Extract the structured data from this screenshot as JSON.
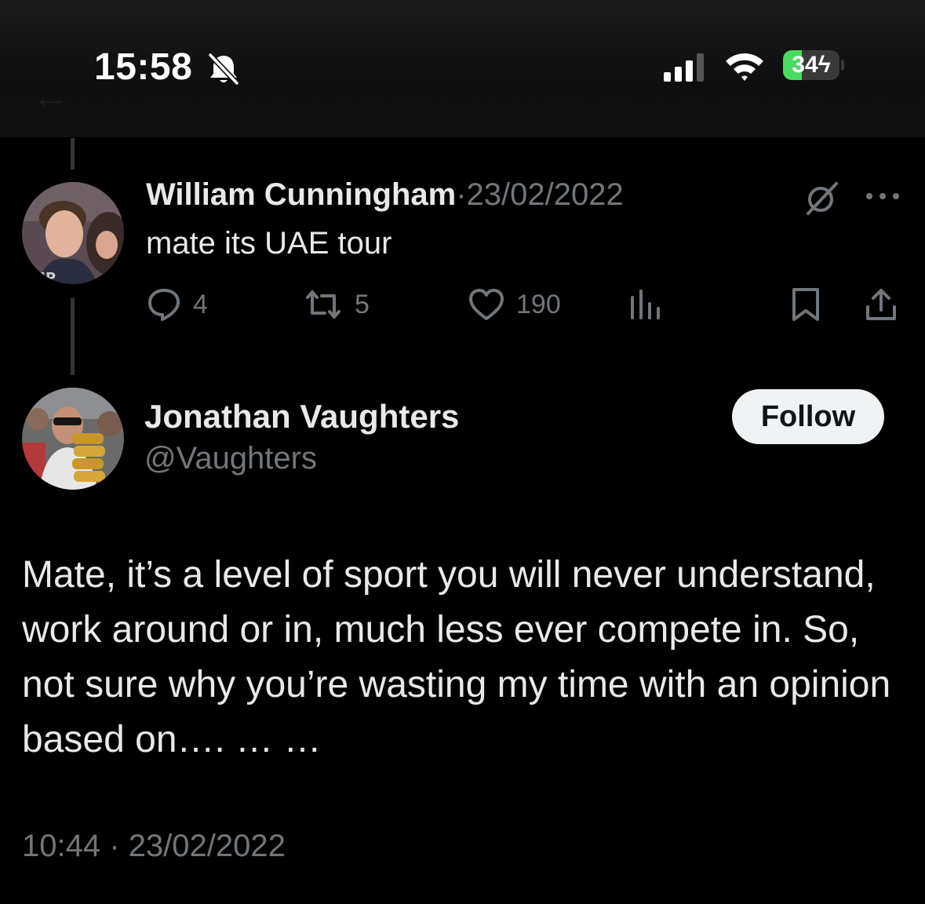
{
  "status_bar": {
    "time": "15:58",
    "battery": {
      "level": 34,
      "label": "34",
      "color": "#4cd964"
    },
    "icons": [
      "bell-slash-icon",
      "cellular-signal-icon",
      "wifi-icon",
      "battery-charging-icon"
    ]
  },
  "reply": {
    "author_name": "William Cunningham",
    "separator": "·",
    "date": "23/02/2022",
    "text": "mate its UAE tour",
    "actions": {
      "replies": "4",
      "reposts": "5",
      "likes": "190"
    }
  },
  "tweet": {
    "author_name": "Jonathan Vaughters",
    "handle": "@Vaughters",
    "follow_label": "Follow",
    "text": "Mate, it’s a level of sport you will never understand, work around or in, much less ever compete in. So, not sure why you’re wasting my time with an opinion based on…. … …",
    "time": "10:44",
    "separator": "·",
    "date": "23/02/2022"
  },
  "colors": {
    "background": "#000000",
    "primary_text": "#e7e9ea",
    "secondary_text": "#71767b",
    "follow_button_bg": "#eff3f4"
  }
}
